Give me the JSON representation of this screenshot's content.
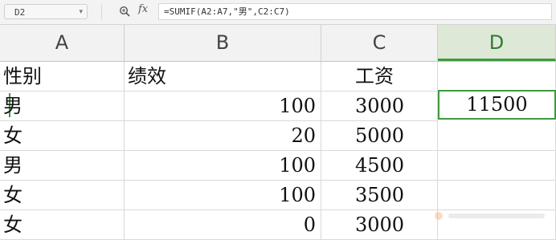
{
  "formula_bar": {
    "name_box": "D2",
    "fx_label": "fx",
    "formula": "=SUMIF(A2:A7,\"男\",C2:C7)"
  },
  "columns": [
    "A",
    "B",
    "C",
    "D"
  ],
  "rows": [
    {
      "a": "性别",
      "b": "绩效",
      "c": "工资",
      "d": ""
    },
    {
      "a": "男",
      "b": "100",
      "c": "3000",
      "d": "11500"
    },
    {
      "a": "女",
      "b": "20",
      "c": "5000",
      "d": ""
    },
    {
      "a": "男",
      "b": "100",
      "c": "4500",
      "d": ""
    },
    {
      "a": "女",
      "b": "100",
      "c": "3500",
      "d": ""
    },
    {
      "a": "女",
      "b": "0",
      "c": "3000",
      "d": ""
    }
  ],
  "selected_cell": "D2",
  "accent_color": "#3f9a3f"
}
